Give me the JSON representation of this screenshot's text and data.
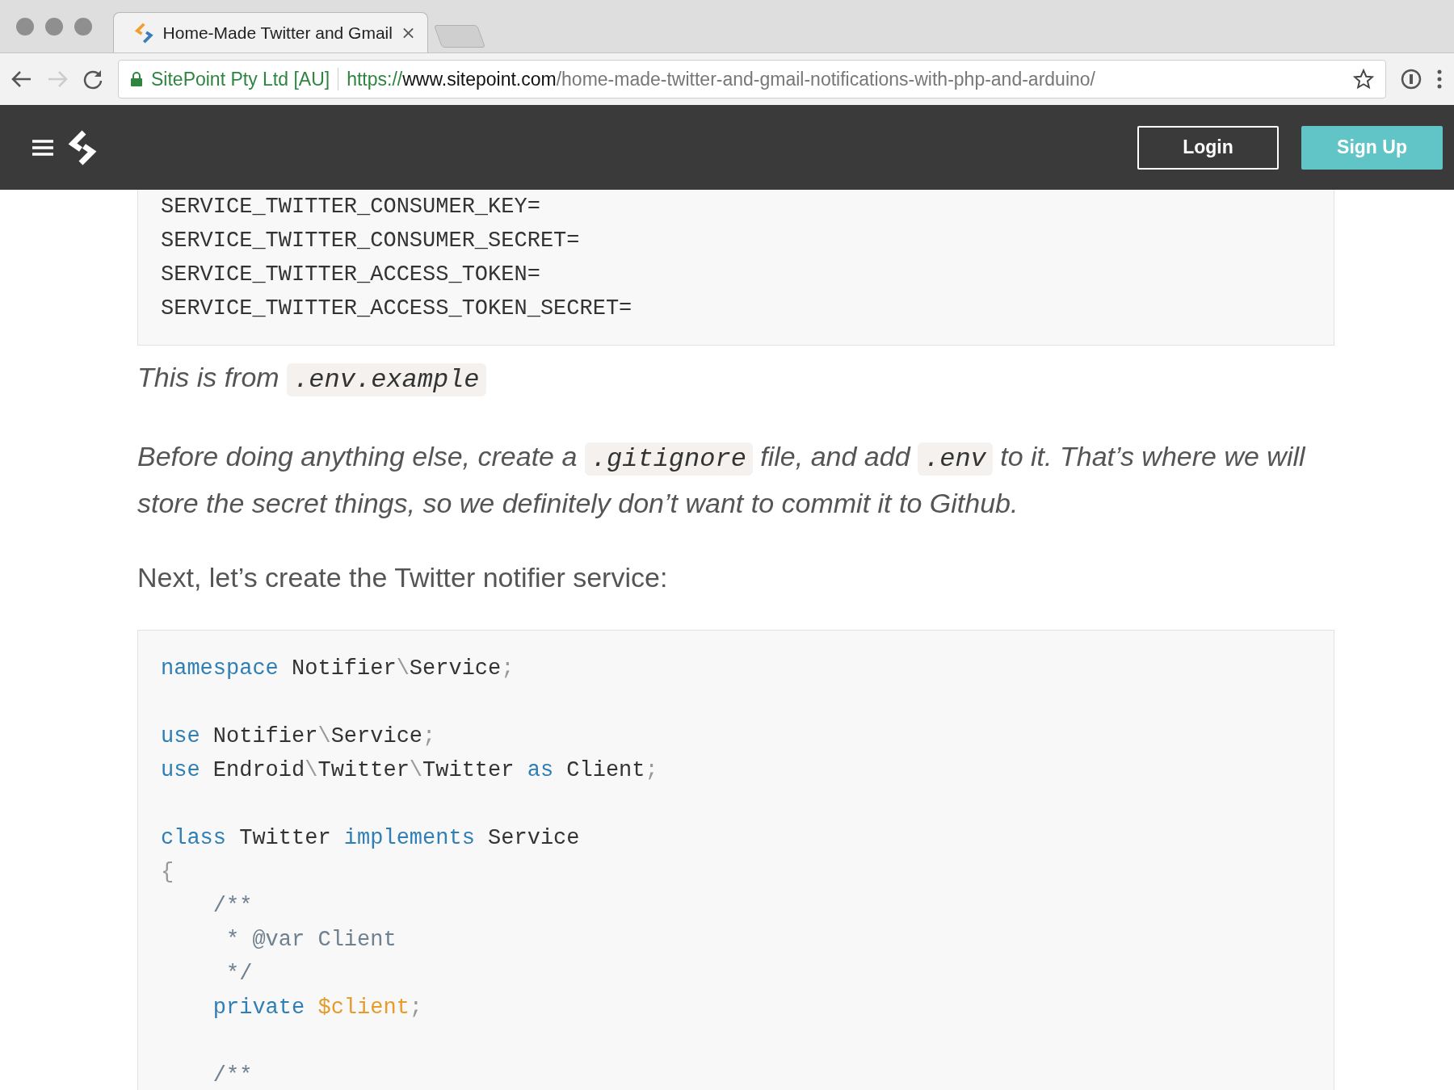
{
  "browser": {
    "tabs": [
      {
        "title": "Home-Made Twitter and Gmail",
        "selected": true
      }
    ],
    "address": {
      "owner": "SitePoint Pty Ltd [AU]",
      "scheme": "https://",
      "host": "www.sitepoint.com",
      "path": "/home-made-twitter-and-gmail-notifications-with-php-and-arduino/"
    }
  },
  "header": {
    "buttons": [
      {
        "label": "Login",
        "kind": "outline"
      },
      {
        "label": "Sign Up",
        "kind": "filled"
      }
    ]
  },
  "content": [
    {
      "kind": "code",
      "lines": [
        {
          "kind": "code_line",
          "tokens": [
            {
              "kind": "plain",
              "text": "SERVICE_TWITTER_CONSUMER_KEY="
            }
          ]
        },
        {
          "kind": "code_line",
          "tokens": [
            {
              "kind": "plain",
              "text": "SERVICE_TWITTER_CONSUMER_SECRET="
            }
          ]
        },
        {
          "kind": "code_line",
          "tokens": [
            {
              "kind": "plain",
              "text": "SERVICE_TWITTER_ACCESS_TOKEN="
            }
          ]
        },
        {
          "kind": "code_line",
          "tokens": [
            {
              "kind": "plain",
              "text": "SERVICE_TWITTER_ACCESS_TOKEN_SECRET="
            }
          ]
        }
      ]
    },
    {
      "kind": "caption",
      "parts": [
        {
          "kind": "text",
          "text": "This is from "
        },
        {
          "kind": "code",
          "text": ".env.example"
        }
      ]
    },
    {
      "kind": "note",
      "parts": [
        {
          "kind": "text",
          "text": "Before doing anything else, create a "
        },
        {
          "kind": "code",
          "text": ".gitignore"
        },
        {
          "kind": "text",
          "text": " file, and add "
        },
        {
          "kind": "code",
          "text": ".env"
        },
        {
          "kind": "text",
          "text": " to it. That’s where we will store the secret things, so we definitely don’t want to commit it to Github."
        }
      ]
    },
    {
      "kind": "text",
      "parts": [
        {
          "kind": "text",
          "text": "Next, let’s create the Twitter notifier service:"
        }
      ]
    },
    {
      "kind": "code",
      "lines": [
        {
          "kind": "code_line",
          "tokens": [
            {
              "kind": "keyword",
              "text": "namespace"
            },
            {
              "kind": "plain",
              "text": " Notifier"
            },
            {
              "kind": "punct",
              "text": "\\"
            },
            {
              "kind": "plain",
              "text": "Service"
            },
            {
              "kind": "punct",
              "text": ";"
            }
          ]
        },
        {
          "kind": "blank"
        },
        {
          "kind": "code_line",
          "tokens": [
            {
              "kind": "keyword",
              "text": "use"
            },
            {
              "kind": "plain",
              "text": " Notifier"
            },
            {
              "kind": "punct",
              "text": "\\"
            },
            {
              "kind": "plain",
              "text": "Service"
            },
            {
              "kind": "punct",
              "text": ";"
            }
          ]
        },
        {
          "kind": "code_line",
          "tokens": [
            {
              "kind": "keyword",
              "text": "use"
            },
            {
              "kind": "plain",
              "text": " Endroid"
            },
            {
              "kind": "punct",
              "text": "\\"
            },
            {
              "kind": "plain",
              "text": "Twitter"
            },
            {
              "kind": "punct",
              "text": "\\"
            },
            {
              "kind": "plain",
              "text": "Twitter "
            },
            {
              "kind": "keyword",
              "text": "as"
            },
            {
              "kind": "plain",
              "text": " Client"
            },
            {
              "kind": "punct",
              "text": ";"
            }
          ]
        },
        {
          "kind": "blank"
        },
        {
          "kind": "code_line",
          "tokens": [
            {
              "kind": "keyword",
              "text": "class"
            },
            {
              "kind": "plain",
              "text": " Twitter "
            },
            {
              "kind": "keyword",
              "text": "implements"
            },
            {
              "kind": "plain",
              "text": " Service"
            }
          ]
        },
        {
          "kind": "code_line",
          "tokens": [
            {
              "kind": "punct",
              "text": "{"
            }
          ]
        },
        {
          "kind": "code_line",
          "tokens": [
            {
              "kind": "comment",
              "text": "    /**"
            }
          ]
        },
        {
          "kind": "code_line",
          "tokens": [
            {
              "kind": "comment",
              "text": "     * @var Client"
            }
          ]
        },
        {
          "kind": "code_line",
          "tokens": [
            {
              "kind": "comment",
              "text": "     */"
            }
          ]
        },
        {
          "kind": "code_line",
          "tokens": [
            {
              "kind": "keyword",
              "text": "    private"
            },
            {
              "kind": "variable",
              "text": " $client"
            },
            {
              "kind": "punct",
              "text": ";"
            }
          ]
        },
        {
          "kind": "blank"
        },
        {
          "kind": "code_line",
          "tokens": [
            {
              "kind": "comment",
              "text": "    /**"
            }
          ]
        }
      ]
    }
  ]
}
